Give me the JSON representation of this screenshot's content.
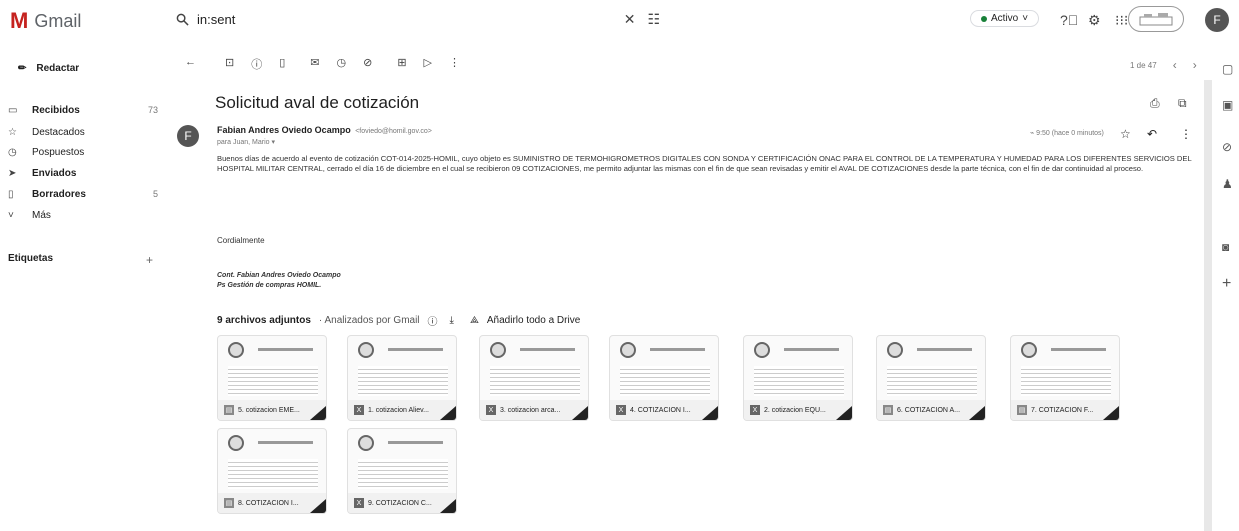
{
  "header": {
    "app_title": "Gmail",
    "search_query": "in:sent",
    "status": "Activo",
    "avatar_letter": "F"
  },
  "sidebar": {
    "compose": "Redactar",
    "items": [
      {
        "label": "Recibidos",
        "count": "73",
        "icon": "inbox-icon"
      },
      {
        "label": "Destacados",
        "count": "",
        "icon": "star-icon"
      },
      {
        "label": "Pospuestos",
        "count": "",
        "icon": "clock-icon"
      },
      {
        "label": "Enviados",
        "count": "",
        "icon": "send-icon"
      },
      {
        "label": "Borradores",
        "count": "5",
        "icon": "draft-icon"
      },
      {
        "label": "Más",
        "count": "",
        "icon": "chevron-down-icon"
      }
    ],
    "labels_title": "Etiquetas",
    "labels_add": "+"
  },
  "toolbar": {
    "pager_text": "1 de 47"
  },
  "message": {
    "subject": "Solicitud aval de cotización",
    "sender_name": "Fabian Andres Oviedo Ocampo",
    "sender_email": "<foviedo@homil.gov.co>",
    "to": "para Juan, Mario",
    "time": "9:50 (hace 0 minutos)",
    "body": "Buenos días de acuerdo al evento de cotización COT-014-2025-HOMIL, cuyo objeto es SUMINISTRO DE TERMOHIGROMETROS DIGITALES CON SONDA Y CERTIFICACIÓN ONAC PARA EL CONTROL DE LA TEMPERATURA Y HUMEDAD PARA LOS DIFERENTES SERVICIOS DEL HOSPITAL MILITAR CENTRAL, cerrado el día 16 de diciembre en el cual se recibieron 09 COTIZACIONES, me permito adjuntar las mismas con el fin de que sean revisadas y emitir el AVAL DE COTIZACIONES desde la parte técnica, con el fin de dar continuidad al proceso.",
    "regards": "Cordialmente",
    "signature_line1": "Cont. Fabian Andres Oviedo Ocampo",
    "signature_line2": "Ps Gestión de compras HOMIL.",
    "attachments_title": "9 archivos adjuntos",
    "attachments_scan": "· Analizados por Gmail",
    "add_to_drive": "Añadirlo todo a Drive"
  },
  "attachments": [
    {
      "name": "5. cotizacion EME...",
      "type": "pdf"
    },
    {
      "name": "1. cotizacion Aliev...",
      "type": "doc"
    },
    {
      "name": "3. cotizacion arca...",
      "type": "doc"
    },
    {
      "name": "4. COTIZACION I...",
      "type": "doc"
    },
    {
      "name": "2. cotizacion EQU...",
      "type": "doc"
    },
    {
      "name": "6. COTIZACION A...",
      "type": "pdf"
    },
    {
      "name": "7. COTIZACION F...",
      "type": "pdf"
    },
    {
      "name": "8. COTIZACION I...",
      "type": "pdf"
    },
    {
      "name": "9. COTIZACION C...",
      "type": "doc"
    }
  ]
}
